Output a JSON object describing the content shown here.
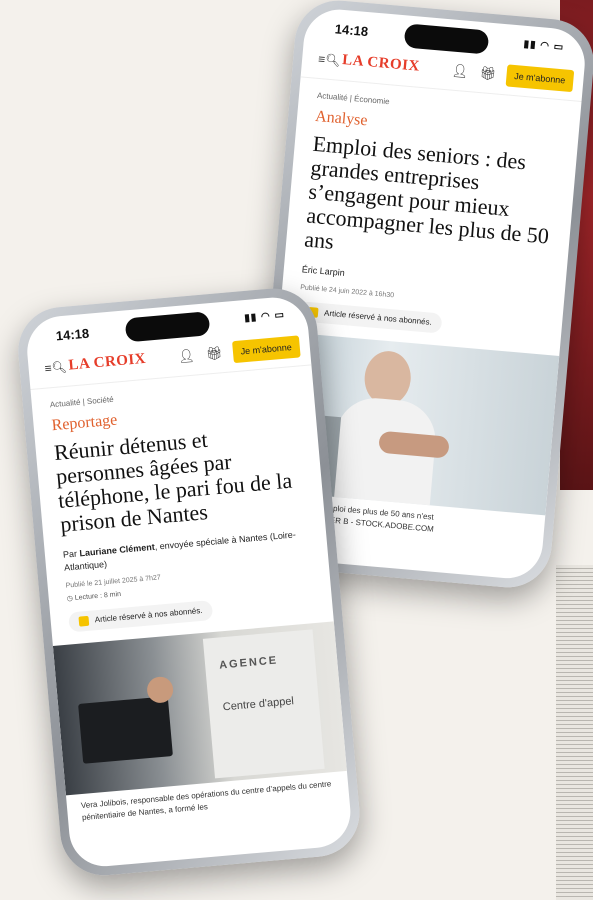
{
  "phones": [
    {
      "status_time": "14:18",
      "brand": "LA CROIX",
      "subscribe_button": "Je m'abonne",
      "breadcrumb": [
        "Actualité",
        "Économie"
      ],
      "rubric": "Analyse",
      "headline": "Emploi des seniors : des grandes entreprises s’engagent pour mieux accompagner les plus de 50 ans",
      "byline": "Éric Larpin",
      "published": "Publié le 24 juin 2022 à 16h30",
      "reserved_label": "Article réservé à nos abonnés.",
      "caption": "ce, le taux d’emploi des plus de 50 ans n’est\n56 %. / SHUTTER B - STOCK.ADOBE.COM"
    },
    {
      "status_time": "14:18",
      "brand": "LA CROIX",
      "subscribe_button": "Je m'abonne",
      "breadcrumb": [
        "Actualité",
        "Société"
      ],
      "rubric": "Reportage",
      "headline": "Réunir détenus et personnes âgées par téléphone, le pari fou de la prison de Nantes",
      "byline_prefix": "Par",
      "byline_author": "Lauriane Clément",
      "byline_rest": ", envoyée spéciale à Nantes (Loire-Atlantique)",
      "published": "Publié le 21 juillet 2025 à 7h27",
      "reading_time": "Lecture : 8 min",
      "reserved_label": "Article réservé à nos abonnés.",
      "photo_sign": "AGENCE",
      "photo_sign2": "Centre d'appel",
      "caption": "Vera Jolibois, responsable des opérations du centre d’appels du centre pénitentiaire de Nantes, a formé les"
    }
  ]
}
